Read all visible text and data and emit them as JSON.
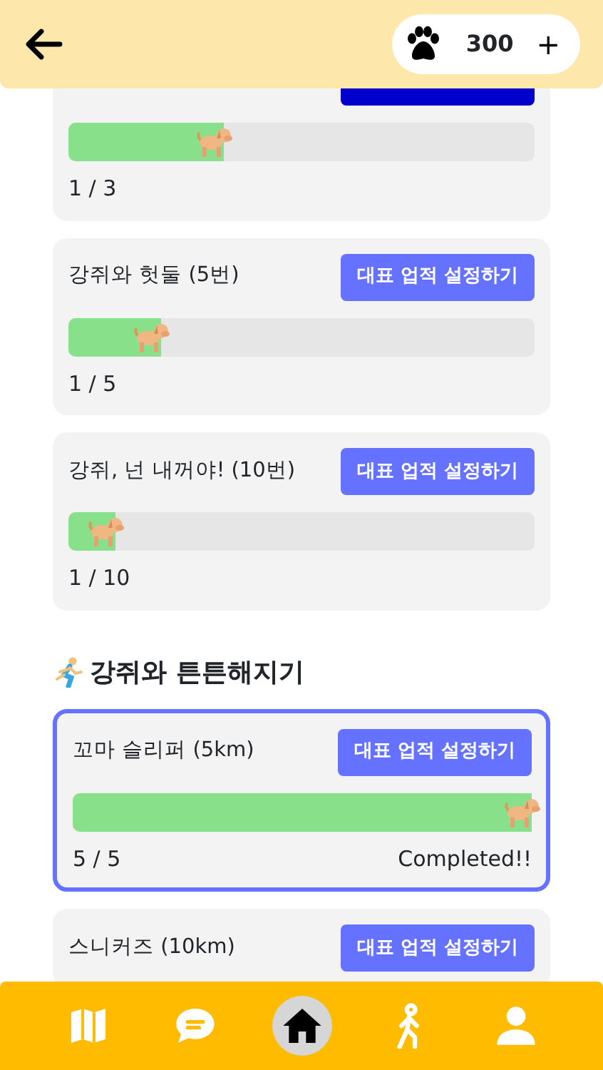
{
  "header": {
    "points": "300",
    "add": "+"
  },
  "groups": [
    {
      "cards": [
        {
          "featured": true,
          "level": 0.333,
          "count": "1 / 3"
        },
        {
          "title": "강쥐와 헛둘 (5번)",
          "button": "대표 업적 설정하기",
          "featured": false,
          "level": 0.2,
          "count": "1 / 5"
        },
        {
          "title": "강쥐, 넌 내꺼야! (10번)",
          "button": "대표 업적 설정하기",
          "featured": false,
          "level": 0.1,
          "count": "1 / 10"
        }
      ]
    },
    {
      "heading": "강쥐와 튼튼해지기",
      "cards": [
        {
          "title": "꼬마 슬리퍼 (5km)",
          "button": "대표 업적 설정하기",
          "featured": false,
          "completed": true,
          "level": 1,
          "count": "5 / 5",
          "status": "Completed!!"
        },
        {
          "title": "스니커즈 (10km)",
          "button": "대표 업적 설정하기",
          "featured": false
        }
      ]
    }
  ],
  "nav": [
    {
      "kind": "map",
      "selected": false
    },
    {
      "kind": "chat",
      "selected": false
    },
    {
      "kind": "home",
      "selected": true
    },
    {
      "kind": "walk",
      "selected": false
    },
    {
      "kind": "person",
      "selected": false
    }
  ]
}
